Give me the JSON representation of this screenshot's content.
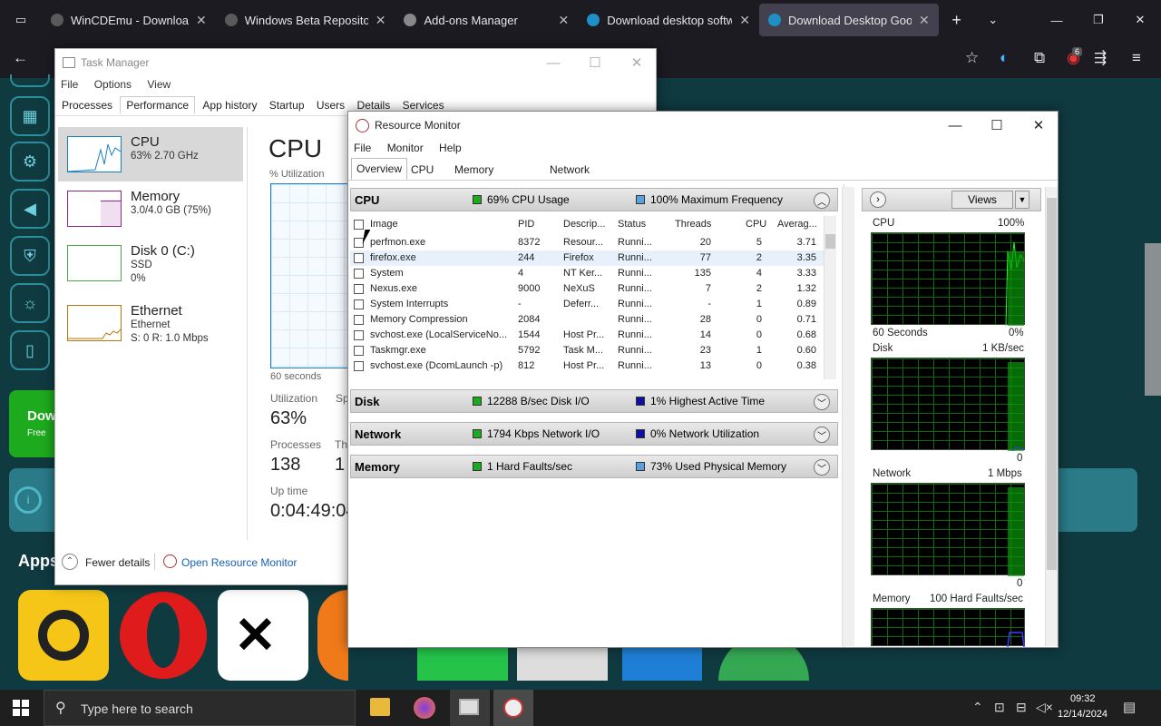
{
  "browser": {
    "tabs": [
      {
        "title": "WinCDEmu - Download",
        "active": false
      },
      {
        "title": "Windows Beta Repository",
        "active": false
      },
      {
        "title": "Add-ons Manager",
        "active": false
      },
      {
        "title": "Download desktop software",
        "active": false
      },
      {
        "title": "Download Desktop Goose",
        "active": true
      }
    ],
    "extension_badge": "6"
  },
  "site": {
    "download_label": "Dow",
    "download_sub": "Free",
    "apps_label": "Apps"
  },
  "task_manager": {
    "title": "Task Manager",
    "menu": [
      "File",
      "Options",
      "View"
    ],
    "tabs": [
      "Processes",
      "Performance",
      "App history",
      "Startup",
      "Users",
      "Details",
      "Services"
    ],
    "items": [
      {
        "name": "CPU",
        "l1": "63% 2.70 GHz",
        "l2": ""
      },
      {
        "name": "Memory",
        "l1": "3.0/4.0 GB (75%)",
        "l2": ""
      },
      {
        "name": "Disk 0 (C:)",
        "l1": "SSD",
        "l2": "0%"
      },
      {
        "name": "Ethernet",
        "l1": "Ethernet",
        "l2": "S: 0 R: 1.0 Mbps"
      }
    ],
    "heading": "CPU",
    "util_label": "% Utilization",
    "seconds_label": "60 seconds",
    "utilization_label": "Utilization",
    "utilization": "63%",
    "speed_label": "Sp",
    "processes_label": "Processes",
    "processes": "138",
    "threads_label": "Th",
    "threads": "1",
    "uptime_label": "Up time",
    "uptime": "0:04:49:04",
    "fewer_details": "Fewer details",
    "open_rm": "Open Resource Monitor"
  },
  "resource_monitor": {
    "title": "Resource Monitor",
    "menu": [
      "File",
      "Monitor",
      "Help"
    ],
    "tabs": [
      "Overview",
      "CPU",
      "Memory",
      "Network"
    ],
    "cpu_section": {
      "name": "CPU",
      "stat1": "69% CPU Usage",
      "stat2": "100% Maximum Frequency"
    },
    "columns": [
      "Image",
      "PID",
      "Descrip...",
      "Status",
      "Threads",
      "CPU",
      "Averag..."
    ],
    "processes": [
      {
        "image": "perfmon.exe",
        "pid": "8372",
        "desc": "Resour...",
        "status": "Runni...",
        "threads": "20",
        "cpu": "5",
        "avg": "3.71"
      },
      {
        "image": "firefox.exe",
        "pid": "244",
        "desc": "Firefox",
        "status": "Runni...",
        "threads": "77",
        "cpu": "2",
        "avg": "3.35"
      },
      {
        "image": "System",
        "pid": "4",
        "desc": "NT Ker...",
        "status": "Runni...",
        "threads": "135",
        "cpu": "4",
        "avg": "3.33"
      },
      {
        "image": "Nexus.exe",
        "pid": "9000",
        "desc": "NeXuS",
        "status": "Runni...",
        "threads": "7",
        "cpu": "2",
        "avg": "1.32"
      },
      {
        "image": "System Interrupts",
        "pid": "-",
        "desc": "Deferr...",
        "status": "Runni...",
        "threads": "-",
        "cpu": "1",
        "avg": "0.89"
      },
      {
        "image": "Memory Compression",
        "pid": "2084",
        "desc": "",
        "status": "Runni...",
        "threads": "28",
        "cpu": "0",
        "avg": "0.71"
      },
      {
        "image": "svchost.exe (LocalServiceNo...",
        "pid": "1544",
        "desc": "Host Pr...",
        "status": "Runni...",
        "threads": "14",
        "cpu": "0",
        "avg": "0.68"
      },
      {
        "image": "Taskmgr.exe",
        "pid": "5792",
        "desc": "Task M...",
        "status": "Runni...",
        "threads": "23",
        "cpu": "1",
        "avg": "0.60"
      },
      {
        "image": "svchost.exe (DcomLaunch -p)",
        "pid": "812",
        "desc": "Host Pr...",
        "status": "Runni...",
        "threads": "13",
        "cpu": "0",
        "avg": "0.38"
      }
    ],
    "disk_section": {
      "name": "Disk",
      "stat1": "12288 B/sec Disk I/O",
      "stat2": "1% Highest Active Time"
    },
    "network_section": {
      "name": "Network",
      "stat1": "1794 Kbps Network I/O",
      "stat2": "0% Network Utilization"
    },
    "memory_section": {
      "name": "Memory",
      "stat1": "1 Hard Faults/sec",
      "stat2": "73% Used Physical Memory"
    },
    "views_label": "Views",
    "graphs": [
      {
        "name": "CPU",
        "max": "100%",
        "foot_left": "60 Seconds",
        "foot_right": "0%"
      },
      {
        "name": "Disk",
        "max": "1 KB/sec",
        "foot_left": "",
        "foot_right": "0"
      },
      {
        "name": "Network",
        "max": "1 Mbps",
        "foot_left": "",
        "foot_right": "0"
      },
      {
        "name": "Memory",
        "max": "100 Hard Faults/sec",
        "foot_left": "",
        "foot_right": ""
      }
    ]
  },
  "taskbar": {
    "search_placeholder": "Type here to search",
    "time": "09:32",
    "date": "12/14/2024"
  },
  "colors": {
    "accent_green": "#1eaa1e",
    "cpu_green": "#00d000",
    "blue_stat": "#1010a0"
  }
}
